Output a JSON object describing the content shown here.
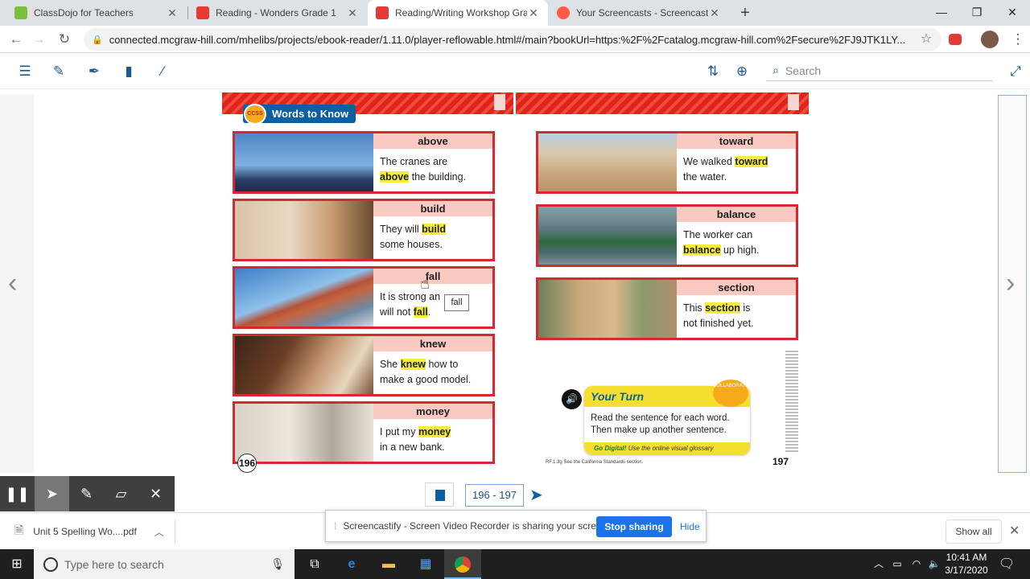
{
  "browser": {
    "tabs": [
      {
        "title": "ClassDojo for Teachers",
        "favicon_color": "#7bbf3b"
      },
      {
        "title": "Reading - Wonders Grade 1",
        "favicon_color": "#e53935"
      },
      {
        "title": "Reading/Writing Workshop Grad",
        "favicon_color": "#e53935",
        "active": true
      },
      {
        "title": "Your Screencasts - Screencastify",
        "favicon_color": "#ff5a43"
      }
    ],
    "new_tab": "+",
    "url": "connected.mcgraw-hill.com/mhelibs/projects/ebook-reader/1.11.0/player-reflowable.html#/main?bookUrl=https:%2F%2Fcatalog.mcgraw-hill.com%2Fsecure%2FJ9JTK1LY..."
  },
  "reader": {
    "search_placeholder": "Search",
    "tools": [
      "toc-icon",
      "highlighter-icon",
      "pen-icon",
      "bookmark-icon",
      "pencil-icon"
    ]
  },
  "page": {
    "section_title": "Words to Know",
    "ccss": "CCSS",
    "left_cards": [
      {
        "word": "above",
        "pre": "The cranes are",
        "hl": "above",
        "post": "the building.",
        "line2_hl_first": true
      },
      {
        "word": "build",
        "pre": "They will",
        "hl": "build",
        "post": "some houses.",
        "line2_hl_first": false
      },
      {
        "word": "fall",
        "pre": "It is strong an",
        "hl": "fall",
        "post": "will not",
        "line2_hl_first": false
      },
      {
        "word": "knew",
        "pre": "She",
        "hl": "knew",
        "post": "how to",
        "line2": "make a good model."
      },
      {
        "word": "money",
        "pre": "I put my",
        "hl": "money",
        "post": "",
        "line2": "in a new bank."
      }
    ],
    "right_cards": [
      {
        "word": "toward",
        "pre": "We walked",
        "hl": "toward",
        "line2": "the water."
      },
      {
        "word": "balance",
        "pre": "The worker can",
        "hl": "balance",
        "line2_post": "up high."
      },
      {
        "word": "section",
        "pre": "This",
        "hl": "section",
        "post": "is",
        "line2": "not finished yet."
      }
    ],
    "tooltip": "fall",
    "left_page_number": "196",
    "right_page_number": "197",
    "your_turn": {
      "title": "Your Turn",
      "body1": "Read the sentence for each word.",
      "body2": "Then make up another sentence.",
      "go_digital": "Go Digital!",
      "go_digital_rest": "Use the online visual glossary",
      "collaborate": "COLLABORATE"
    },
    "standards_note": "RF.1.3g See the California Standards section."
  },
  "pager": {
    "range": "196 - 197"
  },
  "download": {
    "file": "Unit 5 Spelling Wo....pdf",
    "show_all": "Show all"
  },
  "screencastify": {
    "message": "Screencastify - Screen Video Recorder is sharing your screen.",
    "stop": "Stop sharing",
    "hide": "Hide"
  },
  "taskbar": {
    "search_placeholder": "Type here to search",
    "time": "10:41 AM",
    "date": "3/17/2020"
  }
}
